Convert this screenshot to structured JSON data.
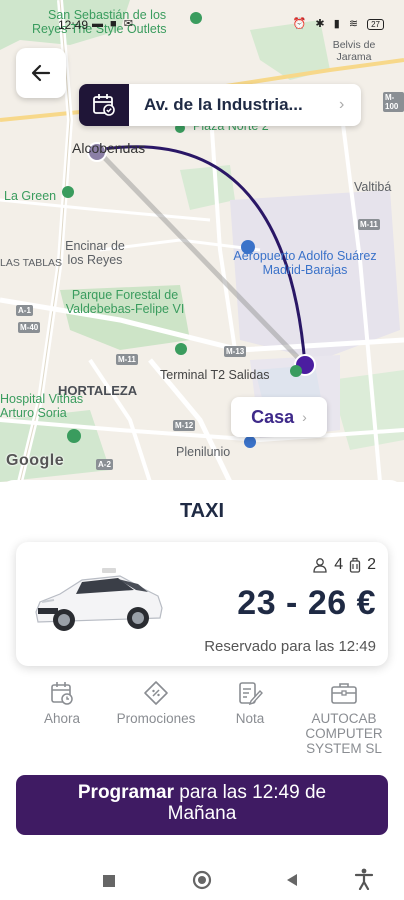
{
  "status_bar": {
    "time": "12:49",
    "battery": "27"
  },
  "map": {
    "labels": {
      "top_text": "San Sebastián de los",
      "top_text2": "Reyes The Style Outlets",
      "belvis": "Belvis de Jarama",
      "plaza_norte": "Plaza Norte 2",
      "alcobendas": "Alcobendas",
      "valtibanez": "Valtibá",
      "la_green": "La Green",
      "encinar": "Encinar de los Reyes",
      "las_tablas": "LAS TABLAS",
      "airport": "Aeropuerto Adolfo Suárez Madrid-Barajas",
      "parque": "Parque Forestal de Valdebebas-Felipe VI",
      "hortaleza": "HORTALEZA",
      "terminal": "Terminal T2 Salidas",
      "hospital": "Hospital Vithas Arturo Soria",
      "plenilunio": "Plenilunio",
      "google": "Google"
    },
    "roads": [
      "M-100",
      "M-11",
      "M-13",
      "M-12",
      "A-1",
      "M-40",
      "A-2",
      "M-11"
    ]
  },
  "origin": {
    "address": "Av. de la Industria..."
  },
  "destination": {
    "label": "Casa"
  },
  "service": {
    "title": "TAXI",
    "passengers": "4",
    "luggage": "2",
    "price": "23 - 26 €",
    "reserved": "Reservado para las 12:49"
  },
  "options": [
    {
      "label": "Ahora",
      "icon": "clock-calendar-icon"
    },
    {
      "label": "Promociones",
      "icon": "tag-icon"
    },
    {
      "label": "Nota",
      "icon": "note-icon"
    },
    {
      "label": "AUTOCAB COMPUTER SYSTEM SL",
      "icon": "briefcase-icon"
    }
  ],
  "cta": {
    "bold": "Programar",
    "rest": "para las 12:49 de",
    "line2": "Mañana"
  },
  "colors": {
    "brand_dark": "#1f1537",
    "cta": "#3f1b63",
    "route": "#2a1766",
    "accent_text": "#3f2a8a"
  }
}
